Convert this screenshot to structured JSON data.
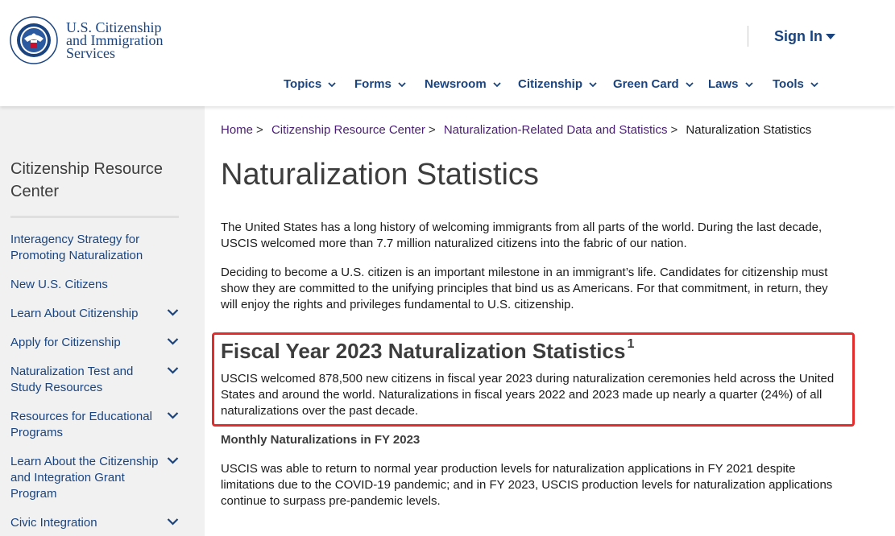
{
  "header": {
    "logo_line1": "U.S. Citizenship",
    "logo_line2": "and Immigration",
    "logo_line3": "Services",
    "signin_label": "Sign In",
    "nav": [
      "Topics",
      "Forms",
      "Newsroom",
      "Citizenship",
      "Green Card",
      "Laws",
      "Tools"
    ]
  },
  "sidebar": {
    "title": "Citizenship Resource Center",
    "items": [
      {
        "label": "Interagency Strategy for Promoting Naturalization",
        "expandable": false
      },
      {
        "label": "New U.S. Citizens",
        "expandable": false
      },
      {
        "label": "Learn About Citizenship",
        "expandable": true
      },
      {
        "label": "Apply for Citizenship",
        "expandable": true
      },
      {
        "label": "Naturalization Test and Study Resources",
        "expandable": true
      },
      {
        "label": "Resources for Educational Programs",
        "expandable": true
      },
      {
        "label": "Learn About the Citizenship and Integration Grant Program",
        "expandable": true
      },
      {
        "label": "Civic Integration",
        "expandable": true
      }
    ]
  },
  "breadcrumb": {
    "items": [
      "Home",
      "Citizenship Resource Center",
      "Naturalization-Related Data and Statistics"
    ],
    "current": "Naturalization Statistics"
  },
  "main": {
    "title": "Naturalization Statistics",
    "intro1": "The United States has a long history of welcoming immigrants from all parts of the world. During the last decade, USCIS welcomed more than 7.7 million naturalized citizens into the fabric of our nation.",
    "intro2": "Deciding to become a U.S. citizen is an important milestone in an immigrant’s life. Candidates for citizenship must show they are committed to the unifying principles that bind us as Americans. For that commitment, in return, they will enjoy the rights and privileges fundamental to U.S. citizenship.",
    "fy_heading": "Fiscal Year 2023 Naturalization Statistics",
    "fy_footnote": "1",
    "fy_text": "USCIS welcomed 878,500 new citizens in fiscal year 2023 during naturalization ceremonies held across the United States and around the world. Naturalizations in fiscal years 2022 and 2023 made up nearly a quarter (24%) of all naturalizations over the past decade.",
    "monthly_heading": "Monthly Naturalizations in FY 2023",
    "monthly_text": "USCIS was able to return to normal year production levels for naturalization applications in FY 2021 despite limitations due to the COVID-19 pandemic; and in FY 2023, USCIS production levels for naturalization applications continue to surpass pre-pandemic levels."
  },
  "colors": {
    "link": "#1a4480",
    "visited": "#4a1e74",
    "highlight": "#e32c2c",
    "sidebar_bg": "#f1f1f1"
  }
}
